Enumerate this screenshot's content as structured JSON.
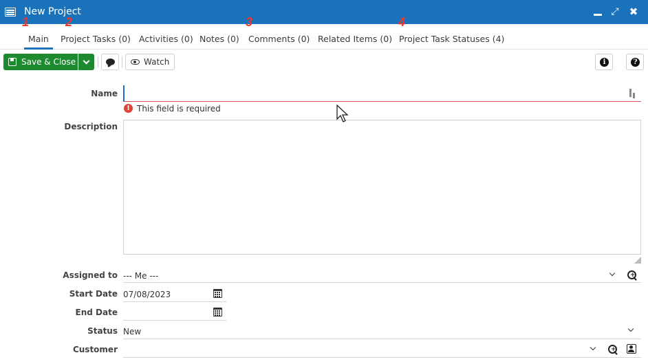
{
  "window": {
    "title": "New Project",
    "icon": "window-list-icon"
  },
  "markers": [
    "1",
    "2",
    "3",
    "4"
  ],
  "tabs": [
    {
      "label": "Main"
    },
    {
      "label": "Project Tasks (0)"
    },
    {
      "label": "Activities (0)"
    },
    {
      "label": "Notes (0)"
    },
    {
      "label": "Comments (0)"
    },
    {
      "label": "Related Items (0)"
    },
    {
      "label": "Project Task Statuses (4)"
    }
  ],
  "toolbar": {
    "save_close_label": "Save & Close",
    "watch_label": "Watch",
    "info_glyph": "i",
    "help_glyph": "?"
  },
  "form": {
    "name": {
      "label": "Name",
      "value": "",
      "error": "This field is required",
      "error_glyph": "!"
    },
    "description": {
      "label": "Description",
      "value": ""
    },
    "assigned_to": {
      "label": "Assigned to",
      "value": "--- Me ---"
    },
    "start_date": {
      "label": "Start Date",
      "value": "07/08/2023"
    },
    "end_date": {
      "label": "End Date",
      "value": ""
    },
    "status": {
      "label": "Status",
      "value": "New"
    },
    "customer": {
      "label": "Customer",
      "value": ""
    }
  },
  "colors": {
    "titlebar": "#1a73ba",
    "save_button": "#1e8a2f",
    "error": "#d9443b",
    "marker": "#e8392f"
  }
}
